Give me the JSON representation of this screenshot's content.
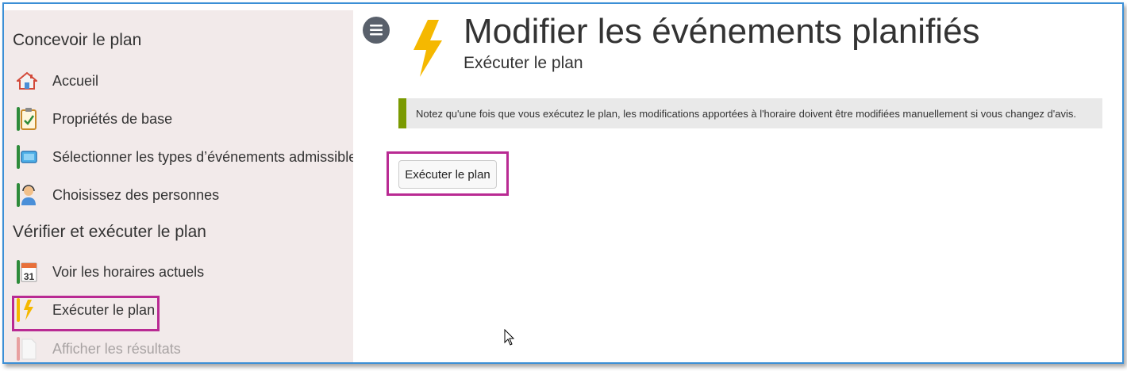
{
  "sidebar": {
    "sections": [
      {
        "title": "Concevoir le plan"
      },
      {
        "title": "Vérifier et exécuter le plan"
      }
    ],
    "items": [
      {
        "label": "Accueil",
        "icon": "house-icon"
      },
      {
        "label": "Propriétés de base",
        "icon": "clipboard-check-icon"
      },
      {
        "label": "Sélectionner les types d’événements admissibles",
        "icon": "screen-icon"
      },
      {
        "label": "Choisissez des personnes",
        "icon": "person-headset-icon"
      },
      {
        "label": "Voir les horaires actuels",
        "icon": "calendar-icon",
        "calendar_day": "31"
      },
      {
        "label": "Exécuter le plan",
        "icon": "lightning-icon",
        "selected": true
      },
      {
        "label": "Afficher les résultats",
        "icon": "document-icon",
        "disabled": true
      }
    ]
  },
  "header": {
    "title": "Modifier les événements planifiés",
    "subtitle": "Exécuter le plan",
    "icon": "lightning-icon"
  },
  "notice": {
    "text": "Notez qu'une fois que vous exécutez le plan, les modifications apportées à l'horaire doivent être modifiées manuellement si vous changez d'avis."
  },
  "actions": {
    "run_label": "Exécuter le plan"
  },
  "colors": {
    "frame_border": "#3b8fd6",
    "sidebar_bg": "#f2eaea",
    "highlight": "#b92a93",
    "notice_accent": "#7a9a01",
    "bolt": "#f5b800",
    "menu_button": "#59606b"
  }
}
